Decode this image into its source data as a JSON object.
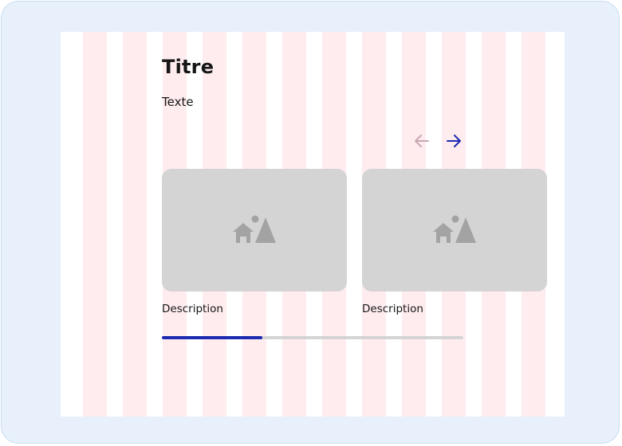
{
  "section": {
    "title": "Titre",
    "text": "Texte"
  },
  "navigation": {
    "prev_icon": "arrow-left-icon",
    "next_icon": "arrow-right-icon",
    "prev_enabled": false,
    "next_enabled": true
  },
  "cards": [
    {
      "image_icon": "image-placeholder-icon",
      "description": "Description"
    },
    {
      "image_icon": "image-placeholder-icon",
      "description": "Description"
    }
  ],
  "progress": {
    "fraction": 0.333
  },
  "colors": {
    "frame_background": "#e7f0fb",
    "grid_column": "#ffecee",
    "accent": "#1d2bb0",
    "disabled_arrow": "#c9a8b6",
    "placeholder": "#d4d4d4",
    "placeholder_icon": "#a3a3a3",
    "text": "#161616"
  }
}
